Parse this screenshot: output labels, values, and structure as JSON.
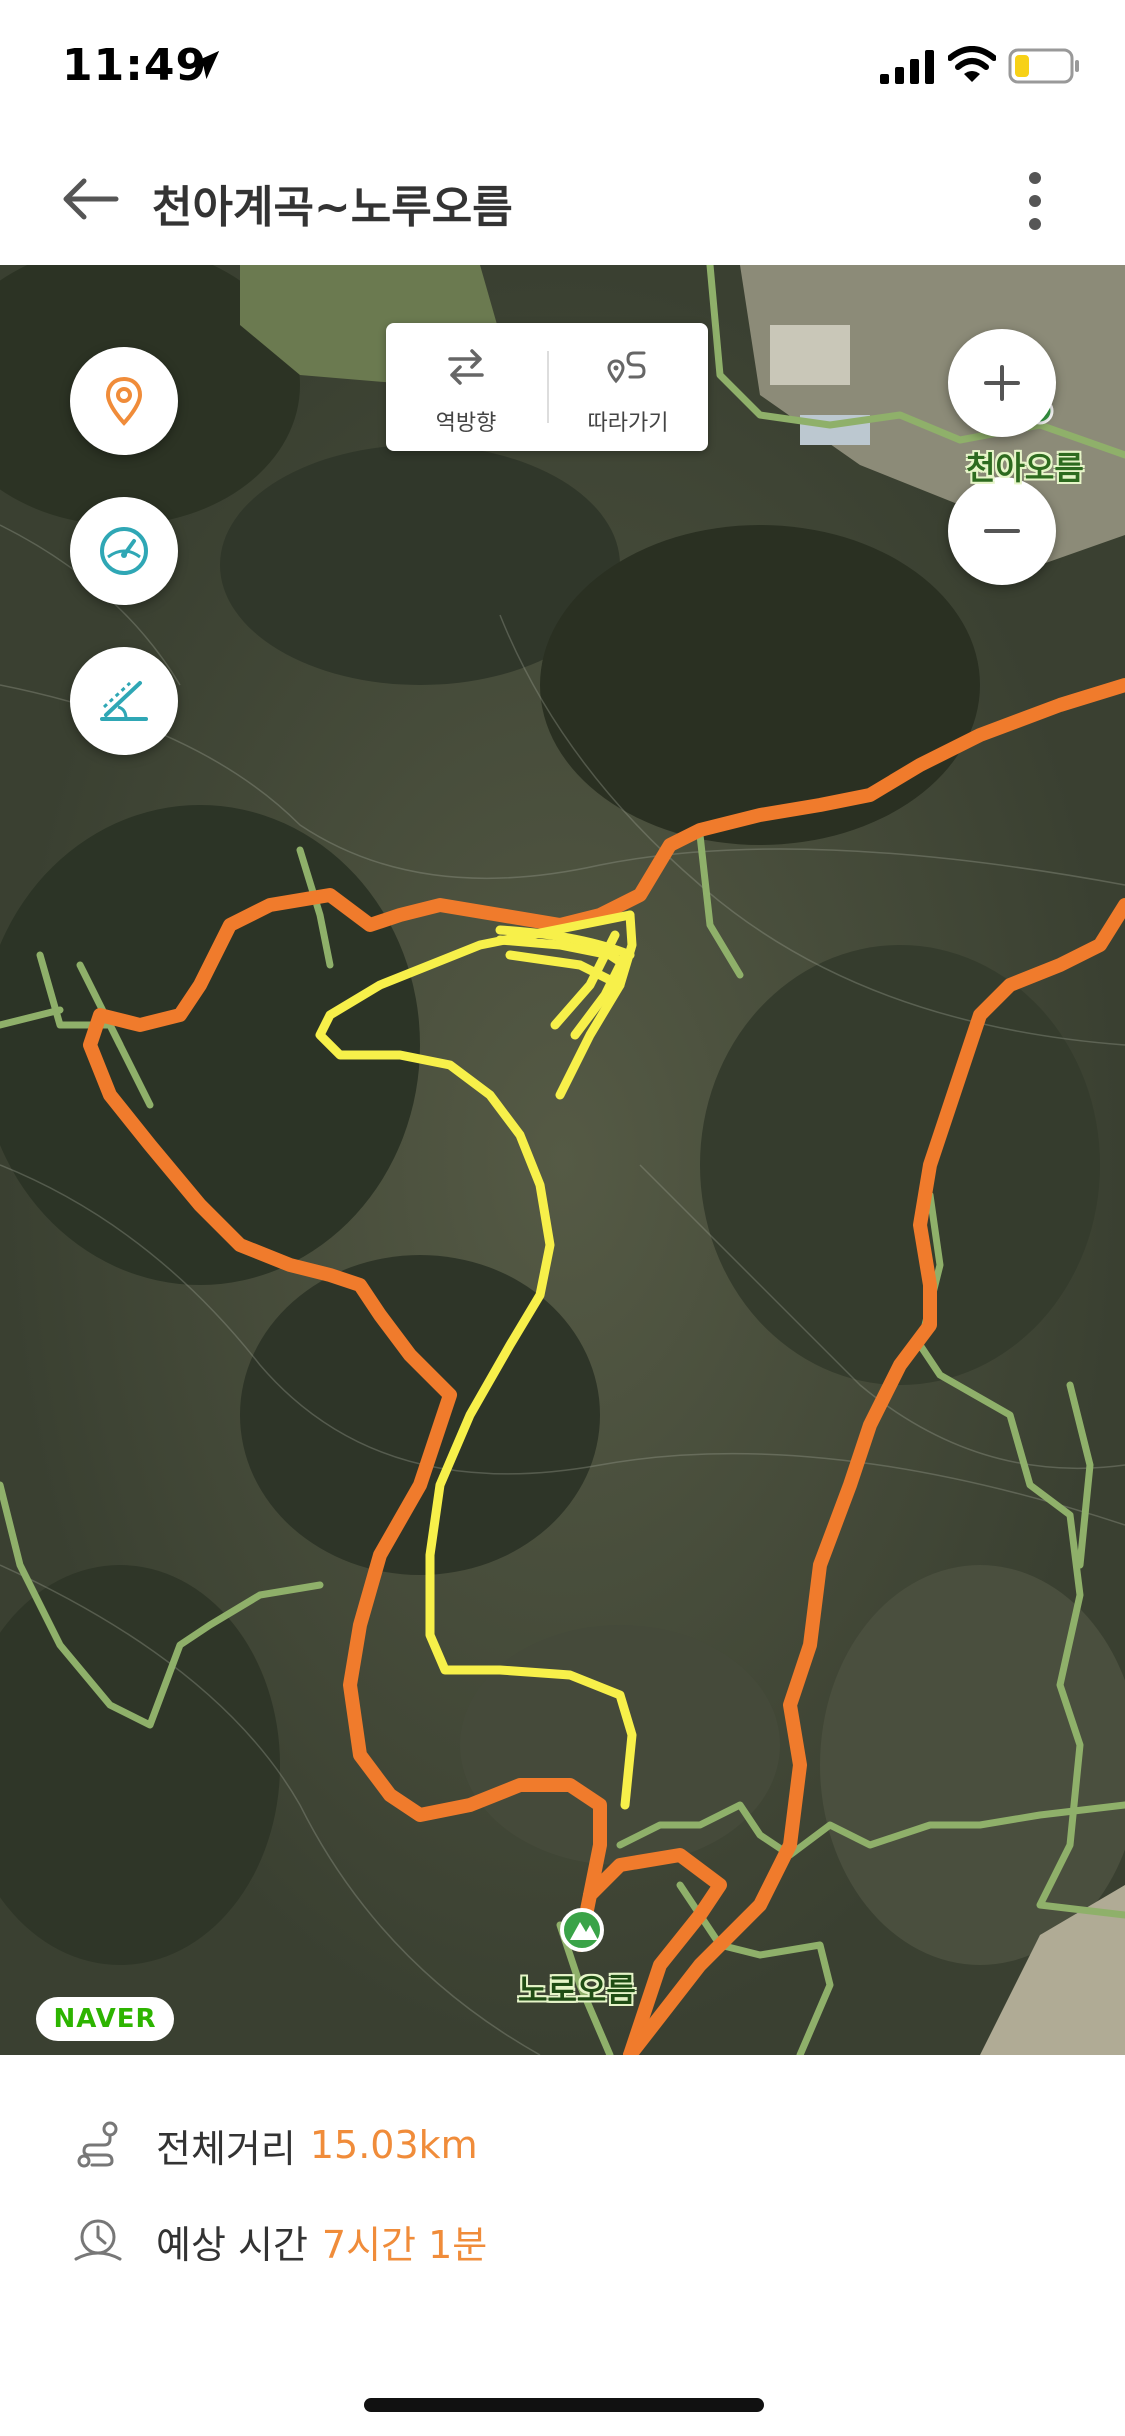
{
  "status_bar": {
    "time": "11:49",
    "icons": [
      "location-arrow-icon",
      "cellular-signal-icon",
      "wifi-icon",
      "battery-low-icon"
    ]
  },
  "header": {
    "title": "천아계곡~노루오름",
    "back_icon": "arrow-left-icon",
    "more_icon": "vertical-ellipsis-icon"
  },
  "map": {
    "buttons": {
      "my_location_icon": "location-pin-icon",
      "speed_icon": "speedometer-icon",
      "slope_icon": "slope-icon",
      "zoom_in": "+",
      "zoom_out": "−"
    },
    "route_tools": {
      "reverse_label": "역방향",
      "follow_label": "따라가기"
    },
    "places": {
      "top_right": "천아오름",
      "bottom": "노로오름"
    },
    "provider_logo": "NAVER",
    "colors": {
      "route": "#f07b2c",
      "trail": "#8fb06a",
      "annotation": "#f7f04a",
      "accent": "#f08c3a"
    }
  },
  "summary": {
    "distance_label": "전체거리",
    "distance_value": "15.03km",
    "time_label": "예상 시간",
    "time_value": "7시간 1분"
  }
}
